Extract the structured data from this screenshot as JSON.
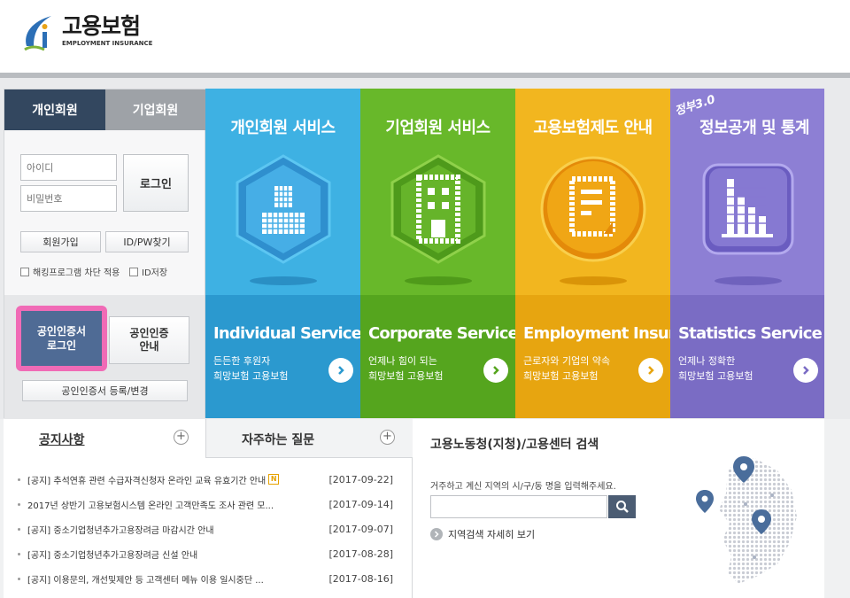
{
  "header": {
    "logo_title": "고용보험",
    "logo_sub": "EMPLOYMENT INSURANCE"
  },
  "login": {
    "tabs": [
      "개인회원",
      "기업회원"
    ],
    "id_placeholder": "아이디",
    "pw_placeholder": "비밀번호",
    "login_label": "로그인",
    "signup_label": "회원가입",
    "find_label": "ID/PW찾기",
    "hack_block_label": "해킹프로그램 차단 적용",
    "id_save_label": "ID저장",
    "cert_login_line1": "공인인증서",
    "cert_login_line2": "로그인",
    "cert_guide_line1": "공인인증",
    "cert_guide_line2": "안내",
    "cert_register_label": "공인인증서 등록/변경"
  },
  "tiles": [
    {
      "title": "개인회원 서비스",
      "en": "Individual Service",
      "desc1": "든든한 후원자",
      "desc2": "희망보험 고용보험",
      "icon": "person-icon"
    },
    {
      "title": "기업회원 서비스",
      "en": "Corporate Service",
      "desc1": "언제나 힘이 되는",
      "desc2": "희망보험 고용보험",
      "icon": "building-icon"
    },
    {
      "title": "고용보험제도 안내",
      "en": "Employment Insurance",
      "desc1": "근로자와 기업의 약속",
      "desc2": "희망보험 고용보험",
      "icon": "document-icon"
    },
    {
      "title": "정보공개 및 통계",
      "en": "Statistics Service",
      "desc1": "언제나 정확한",
      "desc2": "희망보험 고용보험",
      "icon": "bar-chart-icon",
      "badge": "정부3.0"
    }
  ],
  "notice": {
    "tab_label": "공지사항",
    "faq_label": "자주하는 질문",
    "items": [
      {
        "title": "[공지] 추석연휴 관련 수급자격신청자 온라인 교육 유효기간 안내",
        "new": "N",
        "date": "[2017-09-22]"
      },
      {
        "title": "2017년 상반기 고용보험시스템 온라인 고객만족도 조사 관련 모...",
        "date": "[2017-09-14]"
      },
      {
        "title": "[공지] 중소기업청년추가고용장려금 마감시간 안내",
        "date": "[2017-09-07]"
      },
      {
        "title": "[공지] 중소기업청년추가고용장려금 신설 안내",
        "date": "[2017-08-28]"
      },
      {
        "title": "[공지] 이용문의, 개선및제안 등 고객센터 메뉴 이용 일시중단 ...",
        "date": "[2017-08-16]"
      }
    ]
  },
  "search": {
    "title": "고용노동청(지청)/고용센터 검색",
    "desc": "거주하고 계신 지역의 시/구/동 명을 입력해주세요.",
    "detail_link": "지역검색 자세히 보기"
  },
  "colors": {
    "tile1": "#3eb1e3",
    "tile2": "#68b82a",
    "tile3": "#f2b61f",
    "tile4": "#8d7fd4",
    "highlight": "#f06bb6",
    "navy": "#33475f"
  }
}
